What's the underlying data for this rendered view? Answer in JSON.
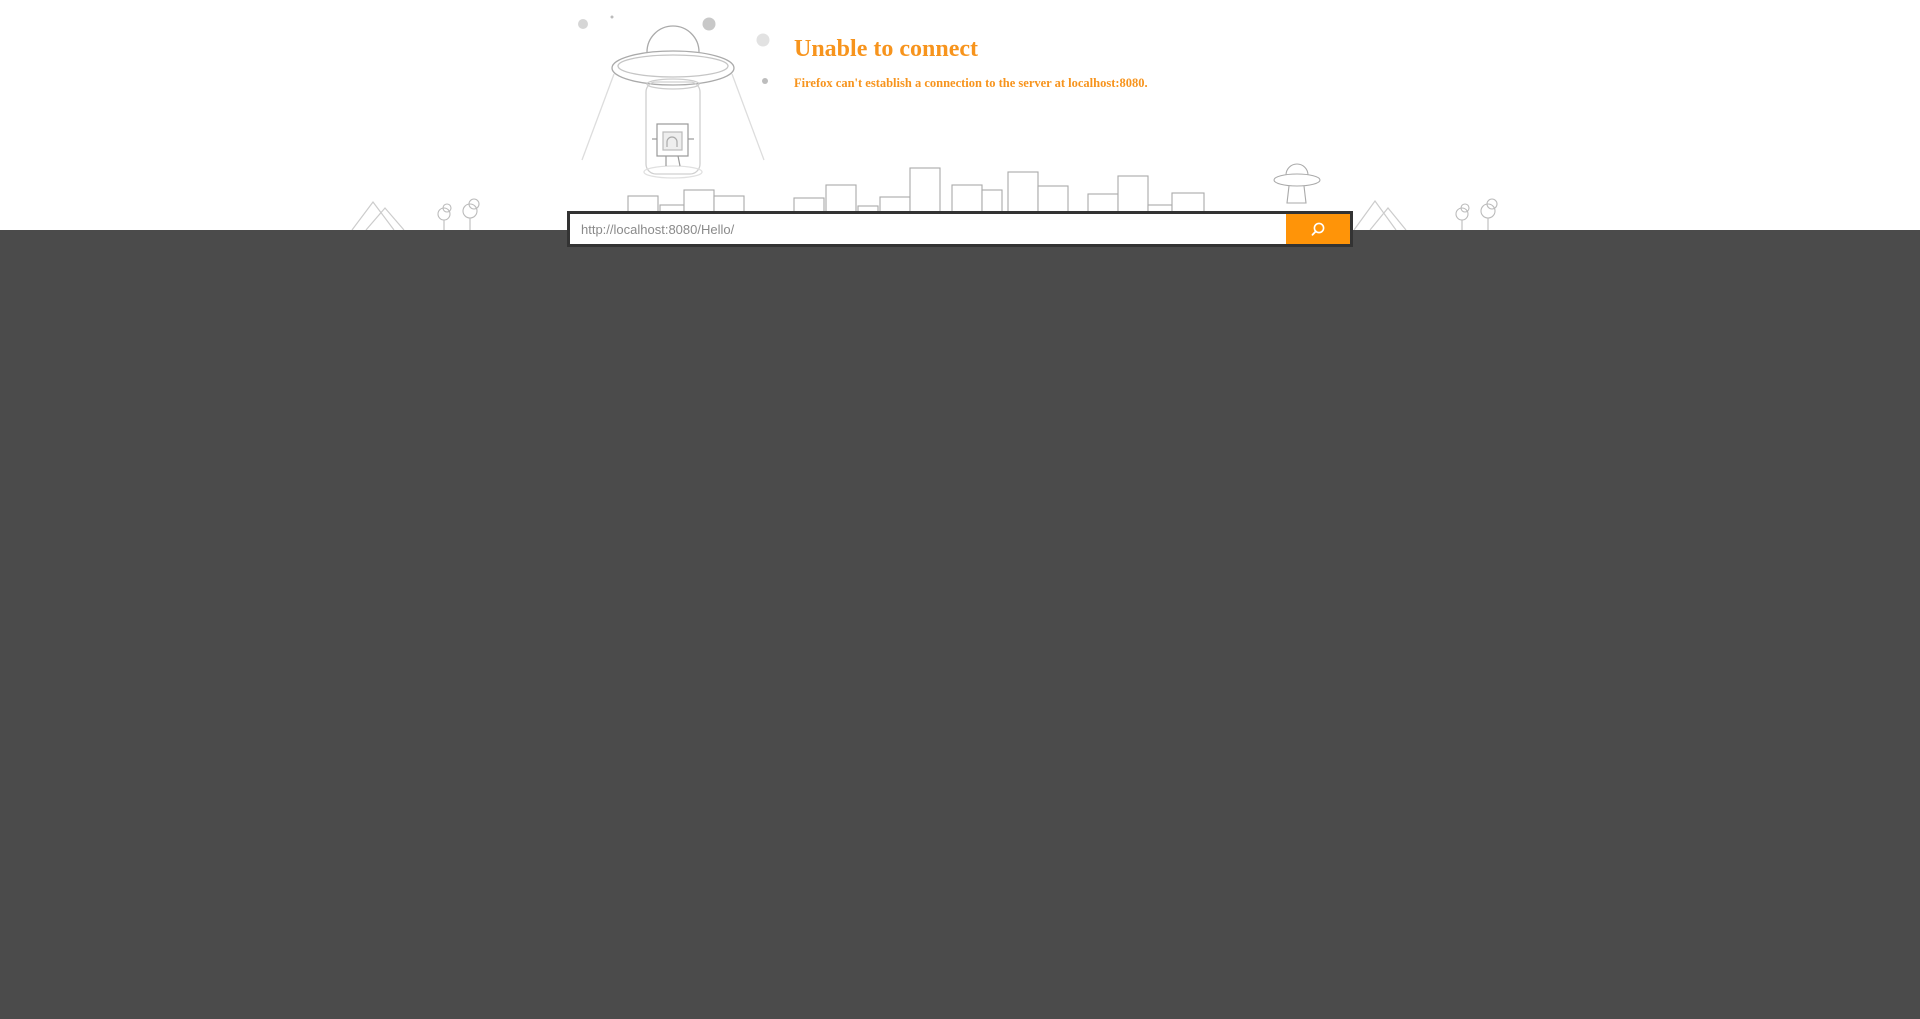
{
  "error": {
    "title": "Unable to connect",
    "description": "Firefox can't establish a connection to the server at localhost:8080."
  },
  "url_bar": {
    "placeholder": "http://localhost:8080/Hello/",
    "value": "",
    "go_icon": "search-icon"
  },
  "colors": {
    "accent": "#ff9408",
    "title_text": "#f7941d",
    "page_background": "#4b4b4b",
    "url_bar_frame": "#333333"
  }
}
